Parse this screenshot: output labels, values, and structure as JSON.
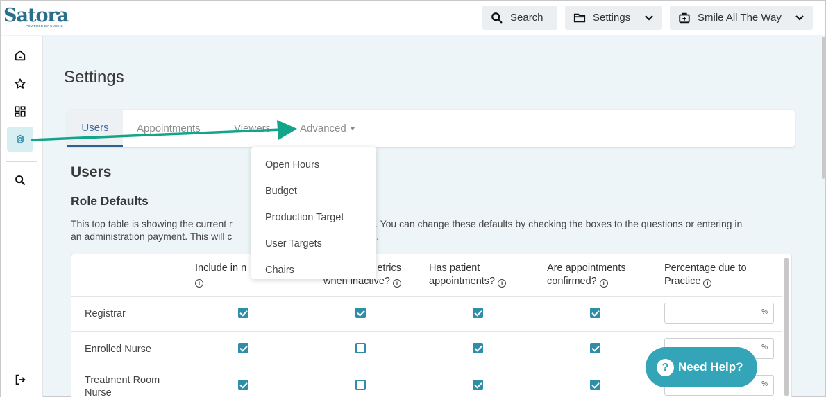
{
  "brand": {
    "logo_text": "Satora",
    "logo_sub": "POWERED BY CUBEIQ"
  },
  "topbar": {
    "search_label": "Search",
    "settings_label": "Settings",
    "practice_label": "Smile All The Way"
  },
  "page": {
    "title": "Settings"
  },
  "tabs": [
    {
      "label": "Users",
      "active": true
    },
    {
      "label": "Appointments"
    },
    {
      "label": "Viewers"
    },
    {
      "label": "Advanced"
    }
  ],
  "advanced_menu": [
    "Open Hours",
    "Budget",
    "Production Target",
    "User Targets",
    "Chairs"
  ],
  "section": {
    "title": "Users",
    "subtitle": "Role Defaults",
    "desc_line1": "This top table is showing the current r                                                   s. You can change these defaults by checking the boxes to the questions or entering in",
    "desc_line2": "an administration payment. This will c                                         w users."
  },
  "table": {
    "headers": [
      {
        "line1": "Include in n",
        "line2": ""
      },
      {
        "line1": "etrics",
        "line2": "when inactive?"
      },
      {
        "line1": "Has patient",
        "line2": "appointments?"
      },
      {
        "line1": "Are appointments",
        "line2": "confirmed?"
      },
      {
        "line1": "Percentage due to",
        "line2": "Practice"
      }
    ],
    "pct_symbol": "%",
    "rows": [
      {
        "label": "Registrar",
        "checks": [
          true,
          true,
          true,
          true
        ]
      },
      {
        "label": "Enrolled Nurse",
        "checks": [
          true,
          false,
          true,
          true
        ]
      },
      {
        "label": "Treatment Room Nurse",
        "label1": "Treatment Room",
        "label2": "Nurse",
        "checks": [
          true,
          false,
          true,
          true
        ]
      }
    ]
  },
  "help": {
    "label": "Need Help?",
    "icon": "?"
  },
  "colors": {
    "accent": "#2e8ea7",
    "arrow": "#12a58a",
    "help": "#34a5b8"
  }
}
